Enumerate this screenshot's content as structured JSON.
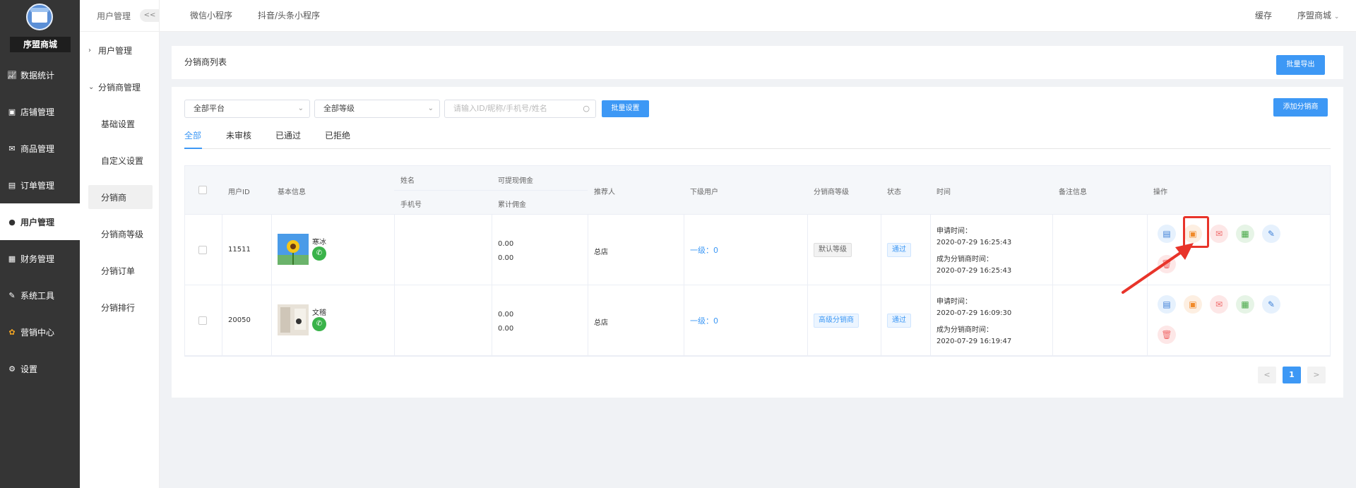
{
  "brand": {
    "name": "序盟商城"
  },
  "sidebar": {
    "items": [
      {
        "label": "数据统计",
        "icon": "chart-icon"
      },
      {
        "label": "店铺管理",
        "icon": "store-icon"
      },
      {
        "label": "商品管理",
        "icon": "goods-icon"
      },
      {
        "label": "订单管理",
        "icon": "order-icon"
      },
      {
        "label": "用户管理",
        "icon": "user-icon",
        "active": true
      },
      {
        "label": "财务管理",
        "icon": "finance-icon"
      },
      {
        "label": "系统工具",
        "icon": "wrench-icon"
      },
      {
        "label": "营销中心",
        "icon": "marketing-icon"
      },
      {
        "label": "设置",
        "icon": "gear-icon"
      }
    ]
  },
  "subnav": {
    "header": "用户管理",
    "collapse": "<<",
    "groups": [
      {
        "label": "用户管理",
        "expanded": false
      },
      {
        "label": "分销商管理",
        "expanded": true
      }
    ],
    "items": [
      {
        "label": "基础设置"
      },
      {
        "label": "自定义设置"
      },
      {
        "label": "分销商",
        "active": true
      },
      {
        "label": "分销商等级"
      },
      {
        "label": "分销订单"
      },
      {
        "label": "分销排行"
      }
    ]
  },
  "topbar": {
    "tabs": [
      "微信小程序",
      "抖音/头条小程序"
    ],
    "cache": "缓存",
    "shop": "序盟商城"
  },
  "list_panel": {
    "title": "分销商列表",
    "export_button": "批量导出"
  },
  "filters": {
    "platform": "全部平台",
    "level": "全部等级",
    "search_placeholder": "请输入ID/昵称/手机号/姓名",
    "batch_button": "批量设置",
    "add_button": "添加分销商"
  },
  "tabs": [
    "全部",
    "未审核",
    "已通过",
    "已拒绝"
  ],
  "table": {
    "headers": {
      "user_id": "用户ID",
      "basic": "基本信息",
      "name": "姓名",
      "phone": "手机号",
      "withdrawable": "可提现佣金",
      "total": "累计佣金",
      "referrer": "推荐人",
      "subordinates": "下级用户",
      "level": "分销商等级",
      "status": "状态",
      "time": "时间",
      "remark": "备注信息",
      "ops": "操作"
    },
    "rows": [
      {
        "id": "11511",
        "nickname": "寒冰",
        "withdrawable": "0.00",
        "total": "0.00",
        "referrer": "总店",
        "subordinates": "一级：0",
        "level": "默认等级",
        "status": "通过",
        "apply_label": "申请时间：",
        "apply_time": "2020-07-29 16:25:43",
        "become_label": "成为分销商时间：",
        "become_time": "2020-07-29 16:25:43"
      },
      {
        "id": "20050",
        "nickname": "文稽",
        "withdrawable": "0.00",
        "total": "0.00",
        "referrer": "总店",
        "subordinates": "一级：0",
        "level": "高级分销商",
        "status": "通过",
        "apply_label": "申请时间：",
        "apply_time": "2020-07-29 16:09:30",
        "become_label": "成为分销商时间：",
        "become_time": "2020-07-29 16:19:47"
      }
    ]
  },
  "pagination": {
    "prev": "<",
    "current": "1",
    "next": ">"
  },
  "colors": {
    "accent": "#3d98f5",
    "sidebar": "#353535",
    "highlight": "#e8342a"
  }
}
